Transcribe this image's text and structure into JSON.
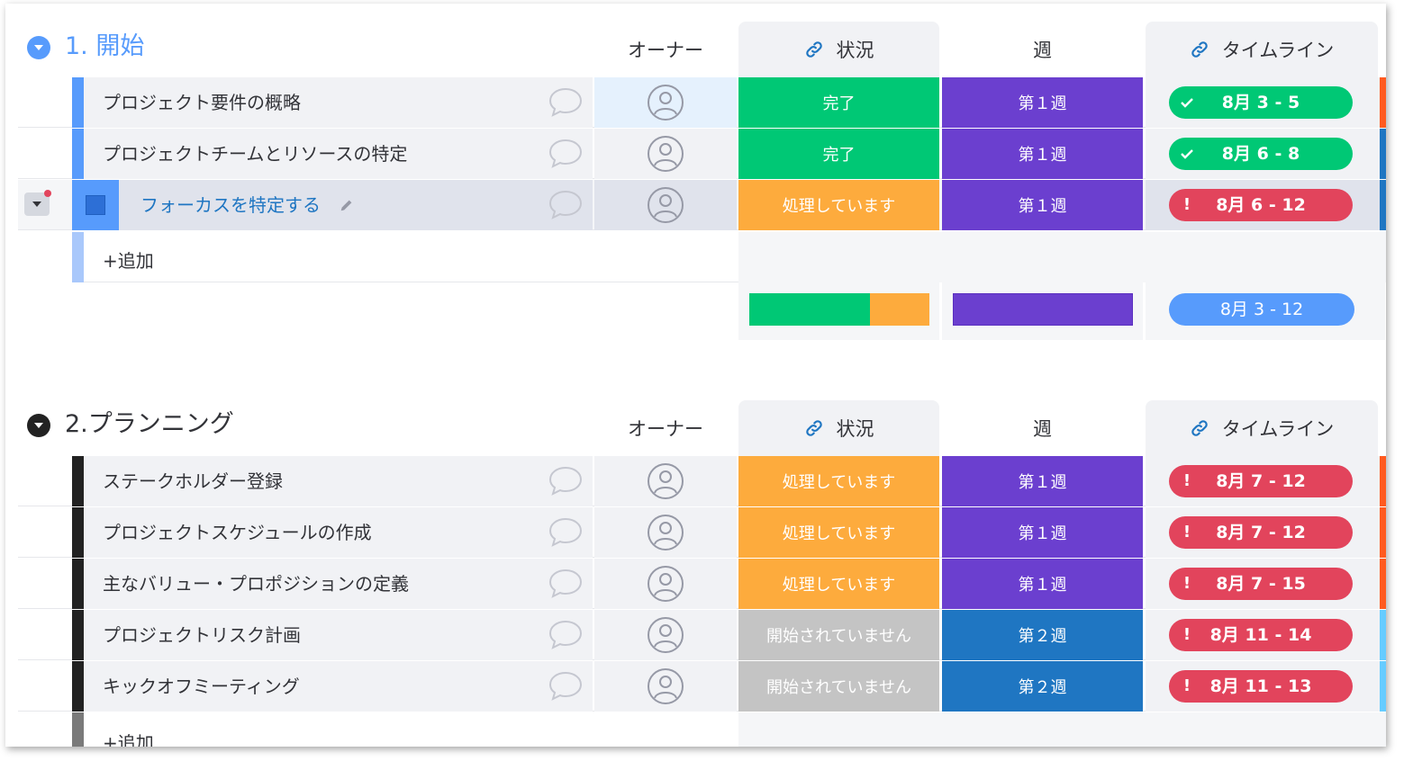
{
  "groups": [
    {
      "title": "1. 開始",
      "color": "#579bfc",
      "columns": {
        "owner": "オーナー",
        "status": "状況",
        "week": "週",
        "timeline": "タイムライン"
      },
      "items": [
        {
          "name": "プロジェクト要件の概略",
          "status": "完了",
          "status_color": "#00c875",
          "week": "第１週",
          "week_color": "#6b3fcf",
          "timeline": "8月 3 - 5",
          "timeline_state": "done",
          "edge_color": "#ff5a1f"
        },
        {
          "name": "プロジェクトチームとリソースの特定",
          "status": "完了",
          "status_color": "#00c875",
          "week": "第１週",
          "week_color": "#6b3fcf",
          "timeline": "8月 6 - 8",
          "timeline_state": "done",
          "edge_color": "#1f76c2"
        },
        {
          "name": "フォーカスを特定する",
          "status": "処理しています",
          "status_color": "#fdab3d",
          "week": "第１週",
          "week_color": "#6b3fcf",
          "timeline": "8月 6 - 12",
          "timeline_state": "overdue",
          "edge_color": "#1f76c2"
        }
      ],
      "add_label": "+追加",
      "summary": {
        "status_done_fraction": 0.67,
        "status_working_fraction": 0.33,
        "timeline": "8月 3 - 12"
      }
    },
    {
      "title": "2.プランニング",
      "color": "#222222",
      "columns": {
        "owner": "オーナー",
        "status": "状況",
        "week": "週",
        "timeline": "タイムライン"
      },
      "items": [
        {
          "name": "ステークホルダー登録",
          "status": "処理しています",
          "status_color": "#fdab3d",
          "week": "第１週",
          "week_color": "#6b3fcf",
          "timeline": "8月 7 - 12",
          "timeline_state": "overdue",
          "edge_color": "#ff5a1f"
        },
        {
          "name": "プロジェクトスケジュールの作成",
          "status": "処理しています",
          "status_color": "#fdab3d",
          "week": "第１週",
          "week_color": "#6b3fcf",
          "timeline": "8月 7 - 12",
          "timeline_state": "overdue",
          "edge_color": "#ff5a1f"
        },
        {
          "name": "主なバリュー・プロポジションの定義",
          "status": "処理しています",
          "status_color": "#fdab3d",
          "week": "第１週",
          "week_color": "#6b3fcf",
          "timeline": "8月 7 - 15",
          "timeline_state": "overdue",
          "edge_color": "#ff5a1f"
        },
        {
          "name": "プロジェクトリスク計画",
          "status": "開始されていません",
          "status_color": "#c4c4c4",
          "week": "第２週",
          "week_color": "#1f76c2",
          "timeline": "8月 11 - 14",
          "timeline_state": "overdue",
          "edge_color": "#66ccff"
        },
        {
          "name": "キックオフミーティング",
          "status": "開始されていません",
          "status_color": "#c4c4c4",
          "week": "第２週",
          "week_color": "#1f76c2",
          "timeline": "8月 11 - 13",
          "timeline_state": "overdue",
          "edge_color": "#66ccff"
        }
      ],
      "add_label": "+追加"
    }
  ]
}
